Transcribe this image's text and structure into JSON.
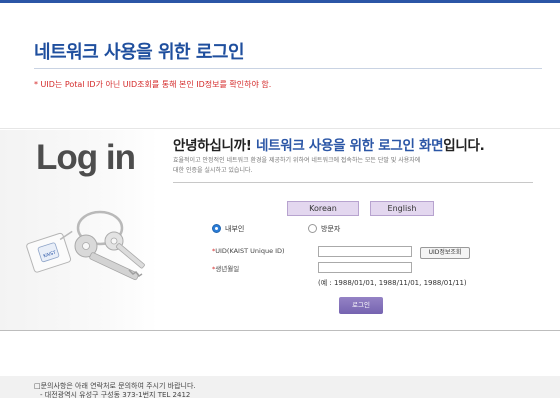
{
  "header": {
    "title": "네트워크 사용을 위한 로그인",
    "notice": "* UID는 Potal ID가 아닌 UID조회를 통해 본인 ID정보를 확인하야 함."
  },
  "hero": {
    "login_word": "Log in",
    "key_tag_text": "KAIST"
  },
  "intro": {
    "greeting_prefix": "안녕하십니까!",
    "greeting_blue1": "네트워크 사용을 위한",
    "greeting_blue2": "로그인 화면",
    "greeting_suffix": "입니다.",
    "description_line1": "효율적이고 안정적인 네트워크 환경을 제공하기 위하여 네트워크에 접속하는 모든 단말 및 사용자에",
    "description_line2": "대한 인증을 실시하고 있습니다."
  },
  "language": {
    "korean": "Korean",
    "english": "English"
  },
  "user_type": {
    "options": [
      "내부인",
      "방문자"
    ],
    "selected": "내부인"
  },
  "form": {
    "uid_label": "UID(KAIST Unique ID)",
    "uid_value": "",
    "birth_label": "생년월일",
    "birth_value": "",
    "required_mark": "*",
    "uid_check_button": "UID정보조회",
    "example": "(예 : 1988/01/01, 1988/11/01, 1988/01/11)",
    "login_button": "로그인"
  },
  "footer": {
    "line1": "□문의사항은 아래 연락처로 문의하여 주시기 바랍니다.",
    "line2": "- 대전광역시 유성구 구성동 373-1번지 TEL 2412"
  },
  "colors": {
    "accent_blue": "#2b56a6",
    "notice_red": "#d42a2a",
    "lang_button_bg": "#e3d7ef",
    "login_button_bg": "#7563b0"
  }
}
